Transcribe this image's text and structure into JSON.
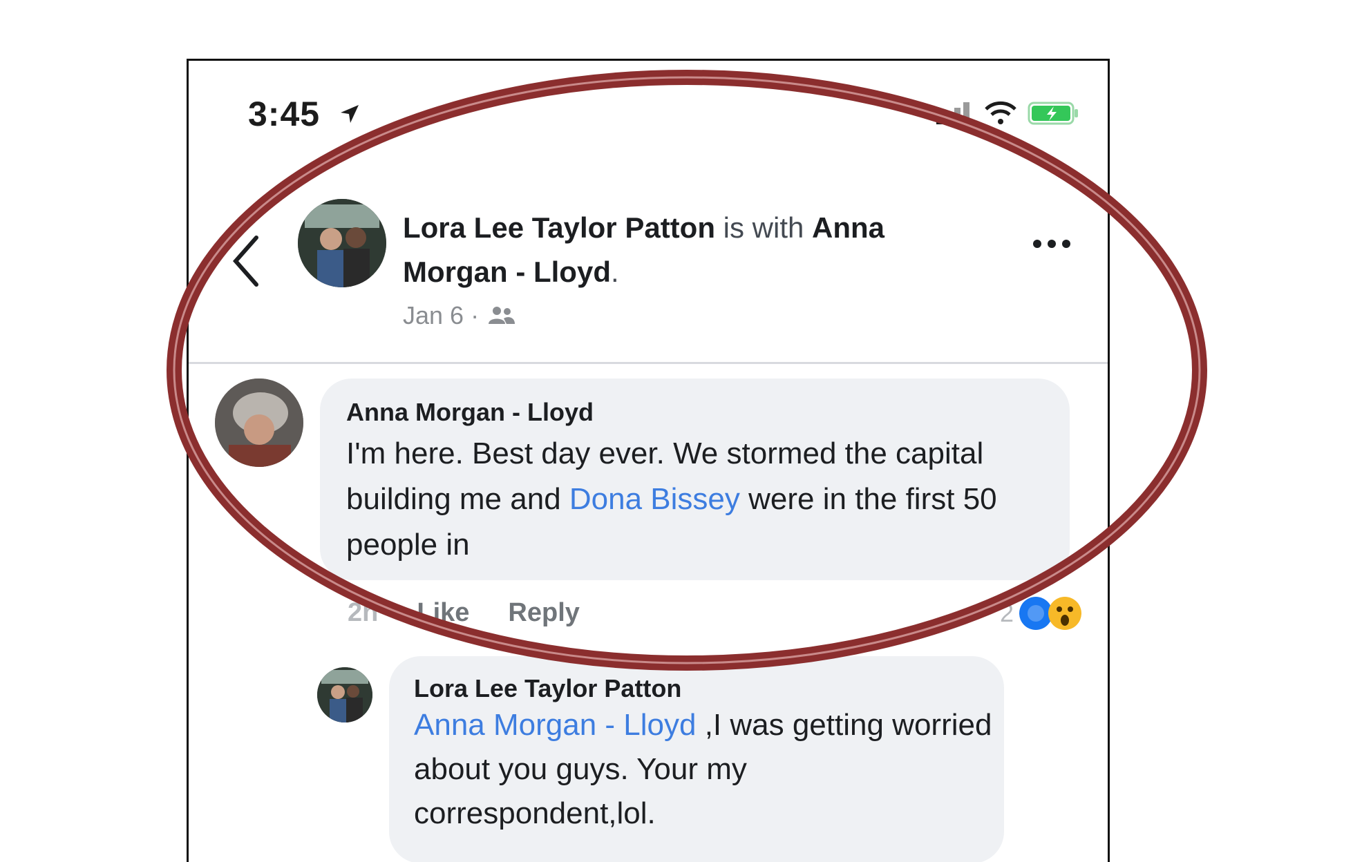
{
  "status_bar": {
    "time": "3:45"
  },
  "post": {
    "author": "Lora Lee Taylor Patton",
    "connector": " is with ",
    "tagged": "Anna Morgan - Lloyd",
    "end_punct": ".",
    "date": "Jan 6 ·",
    "audience_icon": "friends-icon"
  },
  "comments": [
    {
      "author": "Anna Morgan - Lloyd",
      "text_before": "I'm here. Best day ever. We stormed the capital building me and ",
      "mention": "Dona Bissey",
      "text_after": " were in the first 50 people in",
      "actions": {
        "time": "2h",
        "like": "Like",
        "reply": "Reply"
      },
      "reaction_count": "2",
      "reactions": [
        "like-reaction-icon",
        "wow-reaction-icon"
      ]
    },
    {
      "author": "Lora Lee Taylor Patton",
      "mention": "Anna Morgan - Lloyd",
      "text_after": " ,I was getting worried about you guys. Your my correspondent,lol."
    }
  ],
  "colors": {
    "annotation": "#8b2e2e",
    "mention": "#3d7de0",
    "bubble": "#eff1f4",
    "battery": "#34c759"
  }
}
